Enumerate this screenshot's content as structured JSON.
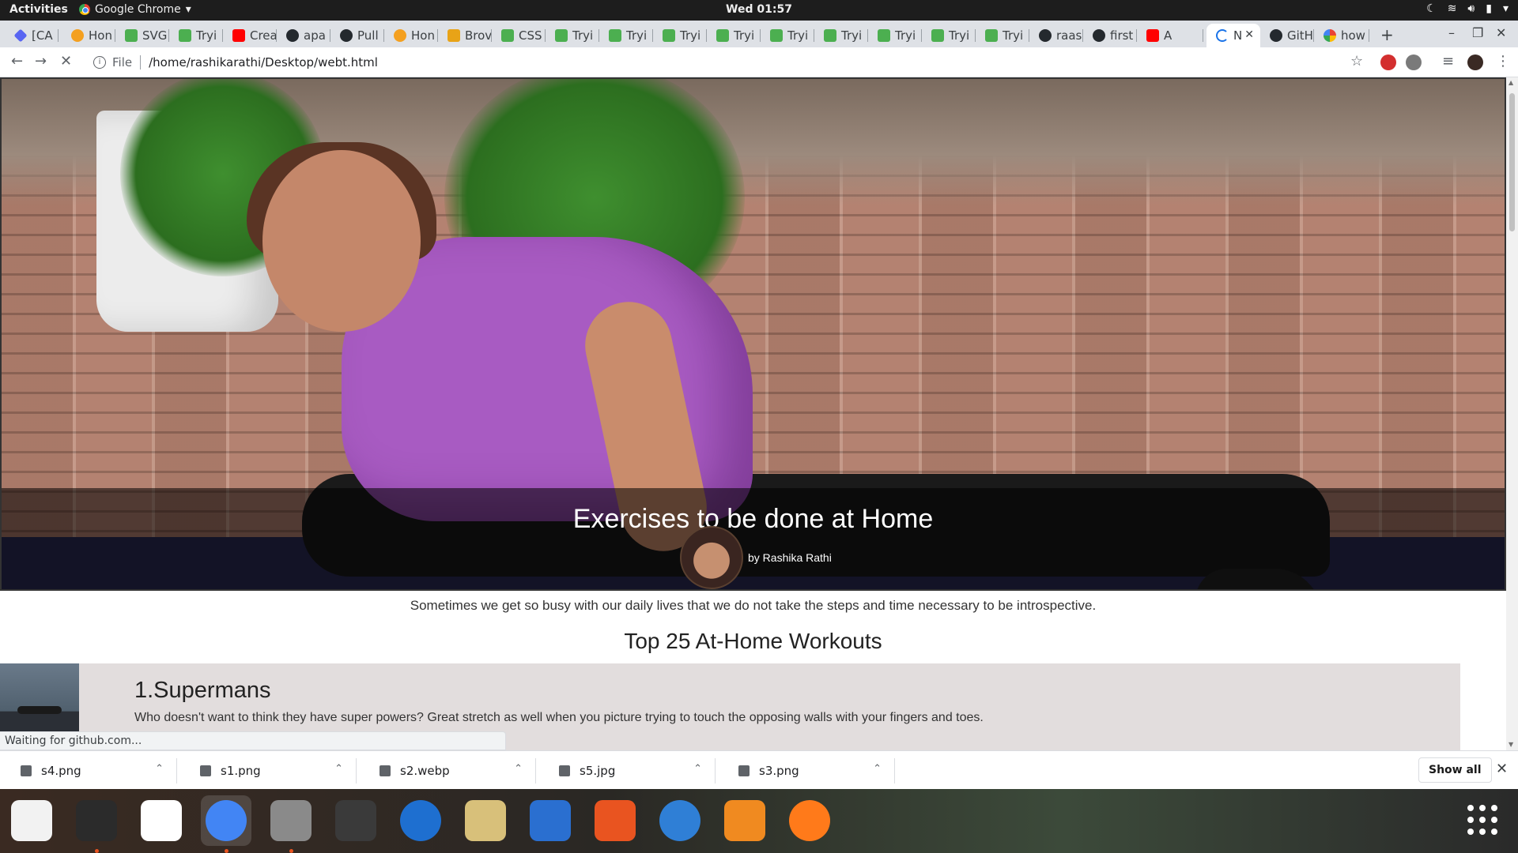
{
  "topbar": {
    "activities": "Activities",
    "app_name": "Google Chrome",
    "clock": "Wed 01:57"
  },
  "tabs": [
    {
      "label": "[CA",
      "icon": "discord-like-icon"
    },
    {
      "label": "Hon",
      "icon": "orange-swirl-icon"
    },
    {
      "label": "SVG",
      "icon": "w3schools-icon"
    },
    {
      "label": "Tryi",
      "icon": "w3schools-icon"
    },
    {
      "label": "Crea",
      "icon": "youtube-icon"
    },
    {
      "label": "apa",
      "icon": "github-icon"
    },
    {
      "label": "Pull",
      "icon": "github-icon"
    },
    {
      "label": "Hon",
      "icon": "orange-swirl-icon"
    },
    {
      "label": "Brov",
      "icon": "r-icon"
    },
    {
      "label": "CSS",
      "icon": "w3schools-icon"
    },
    {
      "label": "Tryi",
      "icon": "w3schools-icon"
    },
    {
      "label": "Tryi",
      "icon": "w3schools-icon"
    },
    {
      "label": "Tryi",
      "icon": "w3schools-icon"
    },
    {
      "label": "Tryi",
      "icon": "w3schools-icon"
    },
    {
      "label": "Tryi",
      "icon": "w3schools-icon"
    },
    {
      "label": "Tryi",
      "icon": "w3schools-icon"
    },
    {
      "label": "Tryi",
      "icon": "w3schools-icon"
    },
    {
      "label": "Tryi",
      "icon": "w3schools-icon"
    },
    {
      "label": "Tryi",
      "icon": "w3schools-icon"
    },
    {
      "label": "raas",
      "icon": "github-icon"
    },
    {
      "label": "first",
      "icon": "github-icon"
    },
    {
      "label": "A",
      "icon": "youtube-icon"
    },
    {
      "label": "N",
      "icon": "loading-spinner-icon",
      "active": true
    },
    {
      "label": "GitH",
      "icon": "github-icon"
    },
    {
      "label": "how",
      "icon": "google-icon"
    }
  ],
  "address_bar": {
    "scheme": "File",
    "url": "/home/rashikarathi/Desktop/webt.html"
  },
  "page": {
    "hero_title": "Exercises to be done at Home",
    "author": "by Rashika Rathi",
    "intro": "Sometimes we get so busy with our daily lives that we do not take the steps and time necessary to be introspective.",
    "section_title": "Top 25 At-Home Workouts",
    "workouts": [
      {
        "title": "1.Supermans",
        "description": "Who doesn't want to think they have super powers?  Great stretch as well when you picture trying to touch the opposing walls with your fingers and toes."
      }
    ]
  },
  "status_text": "Waiting for github.com...",
  "downloads": {
    "items": [
      "s4.png",
      "s1.png",
      "s2.webp",
      "s5.jpg",
      "s3.png"
    ],
    "show_all": "Show all"
  },
  "dock": {
    "apps": [
      "text-editor-icon",
      "terminal-icon",
      "document-viewer-icon",
      "chrome-icon",
      "files-icon",
      "sublime-text-icon",
      "thunderbird-icon",
      "rhythmbox-icon",
      "libreoffice-writer-icon",
      "software-center-icon",
      "help-icon",
      "pdf-editor-icon",
      "firefox-icon"
    ]
  }
}
